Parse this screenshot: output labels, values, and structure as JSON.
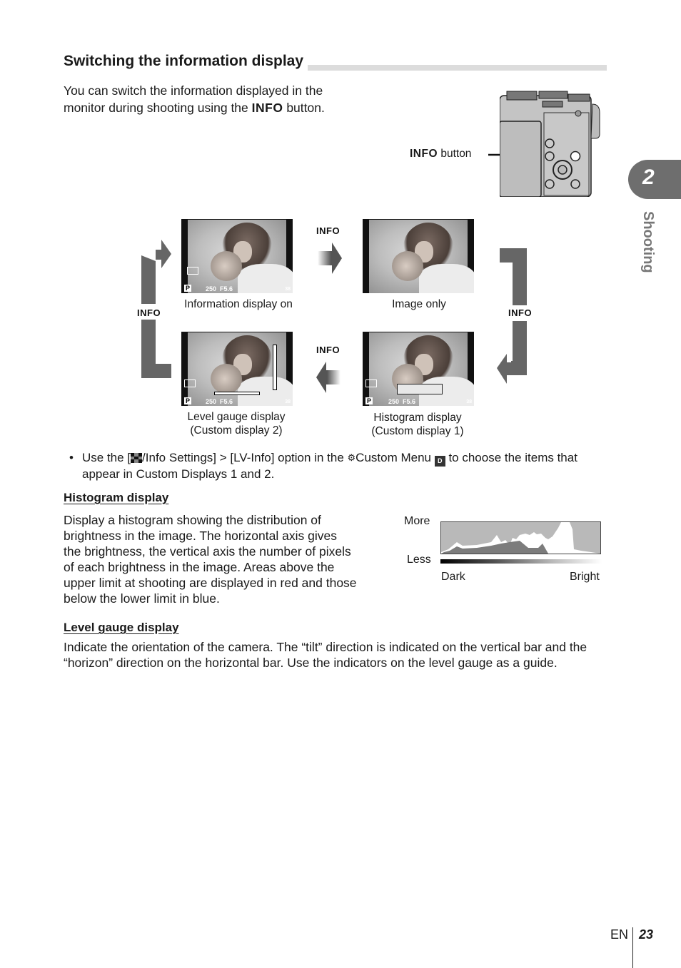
{
  "section": {
    "title": "Switching the information display",
    "intro_before": "You can switch the information displayed in the monitor during shooting using the ",
    "intro_key": "INFO",
    "intro_after": " button."
  },
  "camera_figure": {
    "callout_key": "INFO",
    "callout_text": " button"
  },
  "chapter_tab": {
    "number": "2",
    "label": "Shooting"
  },
  "cycle": {
    "arrow_label": "INFO",
    "screens": [
      {
        "id": "info-on",
        "caption": "Information display on",
        "shutter": "250",
        "aperture": "F5.6",
        "mode": "P",
        "shots": "38"
      },
      {
        "id": "image-only",
        "caption": "Image only"
      },
      {
        "id": "histogram",
        "caption_line1": "Histogram display",
        "caption_line2": "(Custom display 1)",
        "shutter": "250",
        "aperture": "F5.6",
        "mode": "P",
        "shots": "38"
      },
      {
        "id": "level-gauge",
        "caption_line1": "Level gauge display",
        "caption_line2": "(Custom display 2)",
        "shutter": "250",
        "aperture": "F5.6",
        "mode": "P",
        "shots": "38"
      }
    ]
  },
  "bullet": {
    "marker": "•",
    "part1": "Use the [",
    "icon1": "grid-icon",
    "part2": "/Info Settings] > [LV-Info] option in the ",
    "icon2": "gear-icon",
    "gear_glyph": "⚙",
    "part3": "Custom Menu ",
    "icon3_text": "D",
    "part4": " to choose the items that appear in Custom Displays 1 and 2."
  },
  "histogram_section": {
    "heading": "Histogram display",
    "body": "Display a histogram showing the distribution of brightness in the image. The horizontal axis gives the brightness, the vertical axis the number of pixels of each brightness in the image. Areas above the upper limit at shooting are displayed in red and those below the lower limit in blue.",
    "figure": {
      "top_label": "More",
      "bottom_label": "Less",
      "left_label": "Dark",
      "right_label": "Bright"
    }
  },
  "level_section": {
    "heading": "Level gauge display",
    "body": "Indicate the orientation of the camera. The “tilt” direction is indicated on the vertical bar and the “horizon” direction on the horizontal bar. Use the indicators on the level gauge as a guide."
  },
  "footer": {
    "lang": "EN",
    "page": "23"
  },
  "colors": {
    "arrow": "#666666",
    "tab": "#6e6e6e",
    "heading_bar": "#dcdcdc"
  }
}
